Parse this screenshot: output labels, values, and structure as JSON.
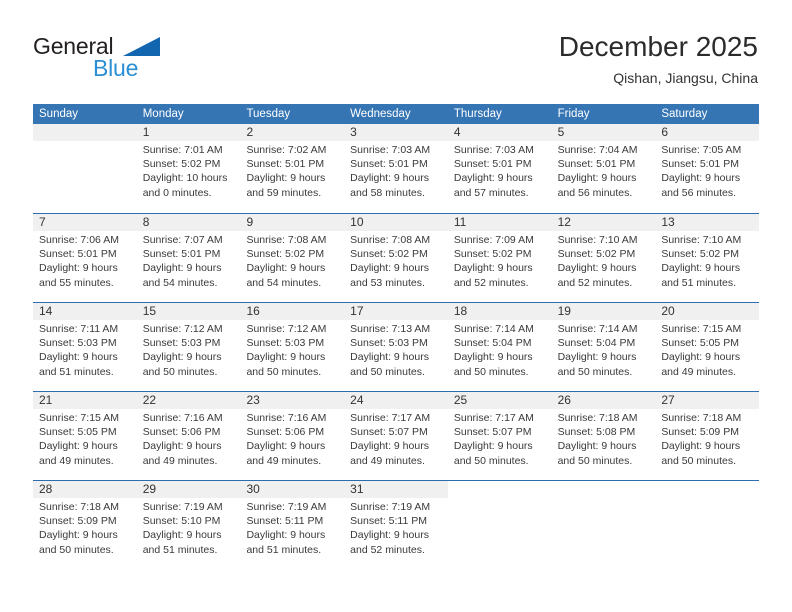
{
  "brand": {
    "name_top": "General",
    "name_bottom": "Blue",
    "accent_color": "#1266b0",
    "accent_color_light": "#2a8fd4"
  },
  "header": {
    "title": "December 2025",
    "subtitle": "Qishan, Jiangsu, China"
  },
  "theme": {
    "header_row_bg": "#3575b4",
    "week_divider": "#2e6cad",
    "daynum_band_bg": "#f0f0f0"
  },
  "weekdays": [
    "Sunday",
    "Monday",
    "Tuesday",
    "Wednesday",
    "Thursday",
    "Friday",
    "Saturday"
  ],
  "weeks": [
    {
      "band_width_pct": 100,
      "days": [
        {
          "num": "",
          "empty": true,
          "sunrise": "",
          "sunset": "",
          "daylight_1": "",
          "daylight_2": ""
        },
        {
          "num": "1",
          "empty": false,
          "sunrise": "Sunrise: 7:01 AM",
          "sunset": "Sunset: 5:02 PM",
          "daylight_1": "Daylight: 10 hours",
          "daylight_2": "and 0 minutes."
        },
        {
          "num": "2",
          "empty": false,
          "sunrise": "Sunrise: 7:02 AM",
          "sunset": "Sunset: 5:01 PM",
          "daylight_1": "Daylight: 9 hours",
          "daylight_2": "and 59 minutes."
        },
        {
          "num": "3",
          "empty": false,
          "sunrise": "Sunrise: 7:03 AM",
          "sunset": "Sunset: 5:01 PM",
          "daylight_1": "Daylight: 9 hours",
          "daylight_2": "and 58 minutes."
        },
        {
          "num": "4",
          "empty": false,
          "sunrise": "Sunrise: 7:03 AM",
          "sunset": "Sunset: 5:01 PM",
          "daylight_1": "Daylight: 9 hours",
          "daylight_2": "and 57 minutes."
        },
        {
          "num": "5",
          "empty": false,
          "sunrise": "Sunrise: 7:04 AM",
          "sunset": "Sunset: 5:01 PM",
          "daylight_1": "Daylight: 9 hours",
          "daylight_2": "and 56 minutes."
        },
        {
          "num": "6",
          "empty": false,
          "sunrise": "Sunrise: 7:05 AM",
          "sunset": "Sunset: 5:01 PM",
          "daylight_1": "Daylight: 9 hours",
          "daylight_2": "and 56 minutes."
        }
      ]
    },
    {
      "band_width_pct": 100,
      "days": [
        {
          "num": "7",
          "empty": false,
          "sunrise": "Sunrise: 7:06 AM",
          "sunset": "Sunset: 5:01 PM",
          "daylight_1": "Daylight: 9 hours",
          "daylight_2": "and 55 minutes."
        },
        {
          "num": "8",
          "empty": false,
          "sunrise": "Sunrise: 7:07 AM",
          "sunset": "Sunset: 5:01 PM",
          "daylight_1": "Daylight: 9 hours",
          "daylight_2": "and 54 minutes."
        },
        {
          "num": "9",
          "empty": false,
          "sunrise": "Sunrise: 7:08 AM",
          "sunset": "Sunset: 5:02 PM",
          "daylight_1": "Daylight: 9 hours",
          "daylight_2": "and 54 minutes."
        },
        {
          "num": "10",
          "empty": false,
          "sunrise": "Sunrise: 7:08 AM",
          "sunset": "Sunset: 5:02 PM",
          "daylight_1": "Daylight: 9 hours",
          "daylight_2": "and 53 minutes."
        },
        {
          "num": "11",
          "empty": false,
          "sunrise": "Sunrise: 7:09 AM",
          "sunset": "Sunset: 5:02 PM",
          "daylight_1": "Daylight: 9 hours",
          "daylight_2": "and 52 minutes."
        },
        {
          "num": "12",
          "empty": false,
          "sunrise": "Sunrise: 7:10 AM",
          "sunset": "Sunset: 5:02 PM",
          "daylight_1": "Daylight: 9 hours",
          "daylight_2": "and 52 minutes."
        },
        {
          "num": "13",
          "empty": false,
          "sunrise": "Sunrise: 7:10 AM",
          "sunset": "Sunset: 5:02 PM",
          "daylight_1": "Daylight: 9 hours",
          "daylight_2": "and 51 minutes."
        }
      ]
    },
    {
      "band_width_pct": 100,
      "days": [
        {
          "num": "14",
          "empty": false,
          "sunrise": "Sunrise: 7:11 AM",
          "sunset": "Sunset: 5:03 PM",
          "daylight_1": "Daylight: 9 hours",
          "daylight_2": "and 51 minutes."
        },
        {
          "num": "15",
          "empty": false,
          "sunrise": "Sunrise: 7:12 AM",
          "sunset": "Sunset: 5:03 PM",
          "daylight_1": "Daylight: 9 hours",
          "daylight_2": "and 50 minutes."
        },
        {
          "num": "16",
          "empty": false,
          "sunrise": "Sunrise: 7:12 AM",
          "sunset": "Sunset: 5:03 PM",
          "daylight_1": "Daylight: 9 hours",
          "daylight_2": "and 50 minutes."
        },
        {
          "num": "17",
          "empty": false,
          "sunrise": "Sunrise: 7:13 AM",
          "sunset": "Sunset: 5:03 PM",
          "daylight_1": "Daylight: 9 hours",
          "daylight_2": "and 50 minutes."
        },
        {
          "num": "18",
          "empty": false,
          "sunrise": "Sunrise: 7:14 AM",
          "sunset": "Sunset: 5:04 PM",
          "daylight_1": "Daylight: 9 hours",
          "daylight_2": "and 50 minutes."
        },
        {
          "num": "19",
          "empty": false,
          "sunrise": "Sunrise: 7:14 AM",
          "sunset": "Sunset: 5:04 PM",
          "daylight_1": "Daylight: 9 hours",
          "daylight_2": "and 50 minutes."
        },
        {
          "num": "20",
          "empty": false,
          "sunrise": "Sunrise: 7:15 AM",
          "sunset": "Sunset: 5:05 PM",
          "daylight_1": "Daylight: 9 hours",
          "daylight_2": "and 49 minutes."
        }
      ]
    },
    {
      "band_width_pct": 100,
      "days": [
        {
          "num": "21",
          "empty": false,
          "sunrise": "Sunrise: 7:15 AM",
          "sunset": "Sunset: 5:05 PM",
          "daylight_1": "Daylight: 9 hours",
          "daylight_2": "and 49 minutes."
        },
        {
          "num": "22",
          "empty": false,
          "sunrise": "Sunrise: 7:16 AM",
          "sunset": "Sunset: 5:06 PM",
          "daylight_1": "Daylight: 9 hours",
          "daylight_2": "and 49 minutes."
        },
        {
          "num": "23",
          "empty": false,
          "sunrise": "Sunrise: 7:16 AM",
          "sunset": "Sunset: 5:06 PM",
          "daylight_1": "Daylight: 9 hours",
          "daylight_2": "and 49 minutes."
        },
        {
          "num": "24",
          "empty": false,
          "sunrise": "Sunrise: 7:17 AM",
          "sunset": "Sunset: 5:07 PM",
          "daylight_1": "Daylight: 9 hours",
          "daylight_2": "and 49 minutes."
        },
        {
          "num": "25",
          "empty": false,
          "sunrise": "Sunrise: 7:17 AM",
          "sunset": "Sunset: 5:07 PM",
          "daylight_1": "Daylight: 9 hours",
          "daylight_2": "and 50 minutes."
        },
        {
          "num": "26",
          "empty": false,
          "sunrise": "Sunrise: 7:18 AM",
          "sunset": "Sunset: 5:08 PM",
          "daylight_1": "Daylight: 9 hours",
          "daylight_2": "and 50 minutes."
        },
        {
          "num": "27",
          "empty": false,
          "sunrise": "Sunrise: 7:18 AM",
          "sunset": "Sunset: 5:09 PM",
          "daylight_1": "Daylight: 9 hours",
          "daylight_2": "and 50 minutes."
        }
      ]
    },
    {
      "band_width_pct": 100,
      "days": [
        {
          "num": "28",
          "empty": false,
          "sunrise": "Sunrise: 7:18 AM",
          "sunset": "Sunset: 5:09 PM",
          "daylight_1": "Daylight: 9 hours",
          "daylight_2": "and 50 minutes."
        },
        {
          "num": "29",
          "empty": false,
          "sunrise": "Sunrise: 7:19 AM",
          "sunset": "Sunset: 5:10 PM",
          "daylight_1": "Daylight: 9 hours",
          "daylight_2": "and 51 minutes."
        },
        {
          "num": "30",
          "empty": false,
          "sunrise": "Sunrise: 7:19 AM",
          "sunset": "Sunset: 5:11 PM",
          "daylight_1": "Daylight: 9 hours",
          "daylight_2": "and 51 minutes."
        },
        {
          "num": "31",
          "empty": false,
          "sunrise": "Sunrise: 7:19 AM",
          "sunset": "Sunset: 5:11 PM",
          "daylight_1": "Daylight: 9 hours",
          "daylight_2": "and 52 minutes."
        },
        {
          "num": "",
          "empty": true,
          "sunrise": "",
          "sunset": "",
          "daylight_1": "",
          "daylight_2": ""
        },
        {
          "num": "",
          "empty": true,
          "sunrise": "",
          "sunset": "",
          "daylight_1": "",
          "daylight_2": ""
        },
        {
          "num": "",
          "empty": true,
          "sunrise": "",
          "sunset": "",
          "daylight_1": "",
          "daylight_2": ""
        }
      ]
    }
  ]
}
